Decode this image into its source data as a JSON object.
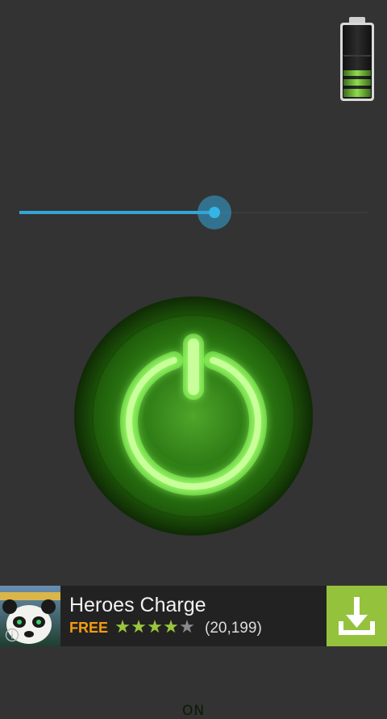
{
  "battery": {
    "level_bars": 3,
    "max_bars": 3,
    "accent": "#7ac943"
  },
  "brightness_slider": {
    "value_fraction": 0.56,
    "accent": "#33b5e5"
  },
  "power_button": {
    "state_label": "ON",
    "glow_color": "#8cff5a"
  },
  "ad": {
    "app_title": "Heroes Charge",
    "price": "FREE",
    "rating_stars": 4,
    "max_stars": 5,
    "rating_count": "(20,199)",
    "icons": {
      "info": "info-icon",
      "download": "download-icon"
    },
    "download_color": "#95c23d"
  }
}
